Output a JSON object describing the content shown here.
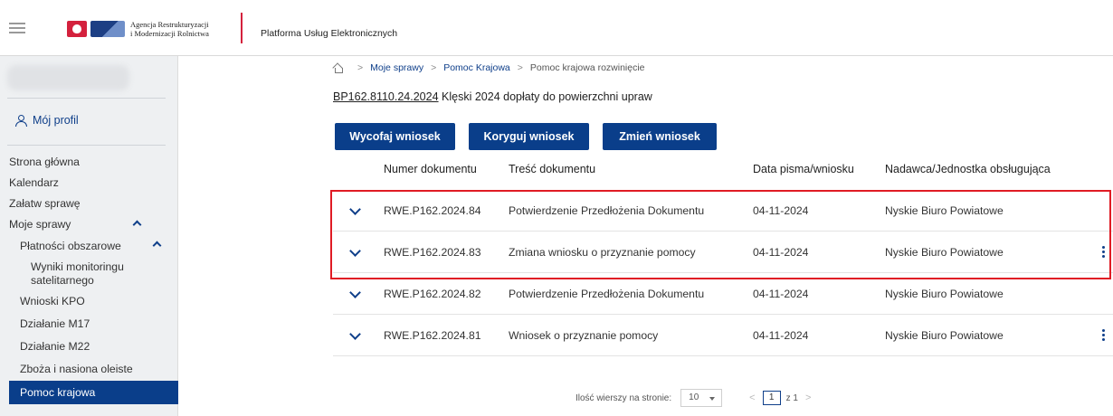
{
  "header": {
    "agency_line1": "Agencja Restrukturyzacji",
    "agency_line2": "i Modernizacji Rolnictwa",
    "platform_title": "Platforma Usług Elektronicznych"
  },
  "sidebar": {
    "profile_label": "Mój profil",
    "items": [
      {
        "label": "Strona główna"
      },
      {
        "label": "Kalendarz"
      },
      {
        "label": "Załatw sprawę"
      },
      {
        "label": "Moje sprawy"
      },
      {
        "label": "Płatności obszarowe"
      },
      {
        "label": "Wyniki monitoringu satelitarnego"
      },
      {
        "label": "Wnioski KPO"
      },
      {
        "label": "Działanie M17"
      },
      {
        "label": "Działanie M22"
      },
      {
        "label": "Zboża i nasiona oleiste"
      },
      {
        "label": "Pomoc krajowa"
      }
    ]
  },
  "breadcrumb": {
    "items": [
      "Moje sprawy",
      "Pomoc Krajowa",
      "Pomoc krajowa rozwinięcie"
    ]
  },
  "case": {
    "number": "BP162.8110.24.2024",
    "title": " Klęski 2024 dopłaty do powierzchni upraw"
  },
  "buttons": {
    "withdraw": "Wycofaj wniosek",
    "correct": "Koryguj wniosek",
    "change": "Zmień wniosek"
  },
  "table": {
    "columns": [
      "Numer dokumentu",
      "Treść dokumentu",
      "Data pisma/wniosku",
      "Nadawca/Jednostka obsługująca"
    ],
    "rows": [
      {
        "number": "RWE.P162.2024.84",
        "content": "Potwierdzenie Przedłożenia Dokumentu",
        "date": "04-11-2024",
        "sender": "Nyskie Biuro Powiatowe"
      },
      {
        "number": "RWE.P162.2024.83",
        "content": "Zmiana wniosku o przyznanie pomocy",
        "date": "04-11-2024",
        "sender": "Nyskie Biuro Powiatowe"
      },
      {
        "number": "RWE.P162.2024.82",
        "content": "Potwierdzenie Przedłożenia Dokumentu",
        "date": "04-11-2024",
        "sender": "Nyskie Biuro Powiatowe"
      },
      {
        "number": "RWE.P162.2024.81",
        "content": "Wniosek o przyznanie pomocy",
        "date": "04-11-2024",
        "sender": "Nyskie Biuro Powiatowe"
      }
    ]
  },
  "pager": {
    "rows_label": "Ilość wierszy na stronie:",
    "rows_value": "10",
    "page": "1",
    "of_label": "z 1"
  },
  "colors": {
    "primary": "#0a3e8a",
    "highlight": "#e01b24",
    "brand_red": "#d4213d"
  }
}
